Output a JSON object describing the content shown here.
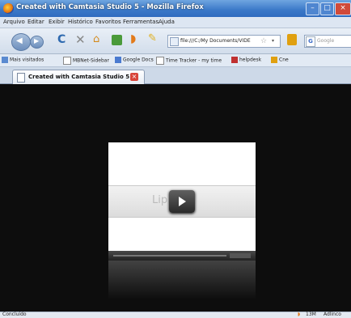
{
  "window": {
    "title": "Created with Camtasia Studio 5 - Mozilla Firefox",
    "controls": [
      "–",
      "□",
      "×"
    ]
  },
  "menu": [
    "Arquivo",
    "Editar",
    "Exibir",
    "Histórico",
    "Favoritos",
    "Ferramentas",
    "Ajuda"
  ],
  "nav": {
    "url": "file:///C:/My Documents/VIDE",
    "search_placeholder": "Google"
  },
  "bookmarks": [
    "Mais visitados",
    "MBNet-Sidebar",
    "Google Docs",
    "Time Tracker - my time",
    "helpdesk",
    "Cne"
  ],
  "tab": {
    "label": "Created with Camtasia Studio 5"
  },
  "video": {
    "overlay_text": "Lip    eo"
  },
  "status": {
    "left": "Concluído",
    "right_a": "13M",
    "right_b": "Adlinco"
  },
  "colors": {
    "titlebar": "#3a78c8",
    "content_bg": "#0d0d0d",
    "close": "#d8453a"
  }
}
